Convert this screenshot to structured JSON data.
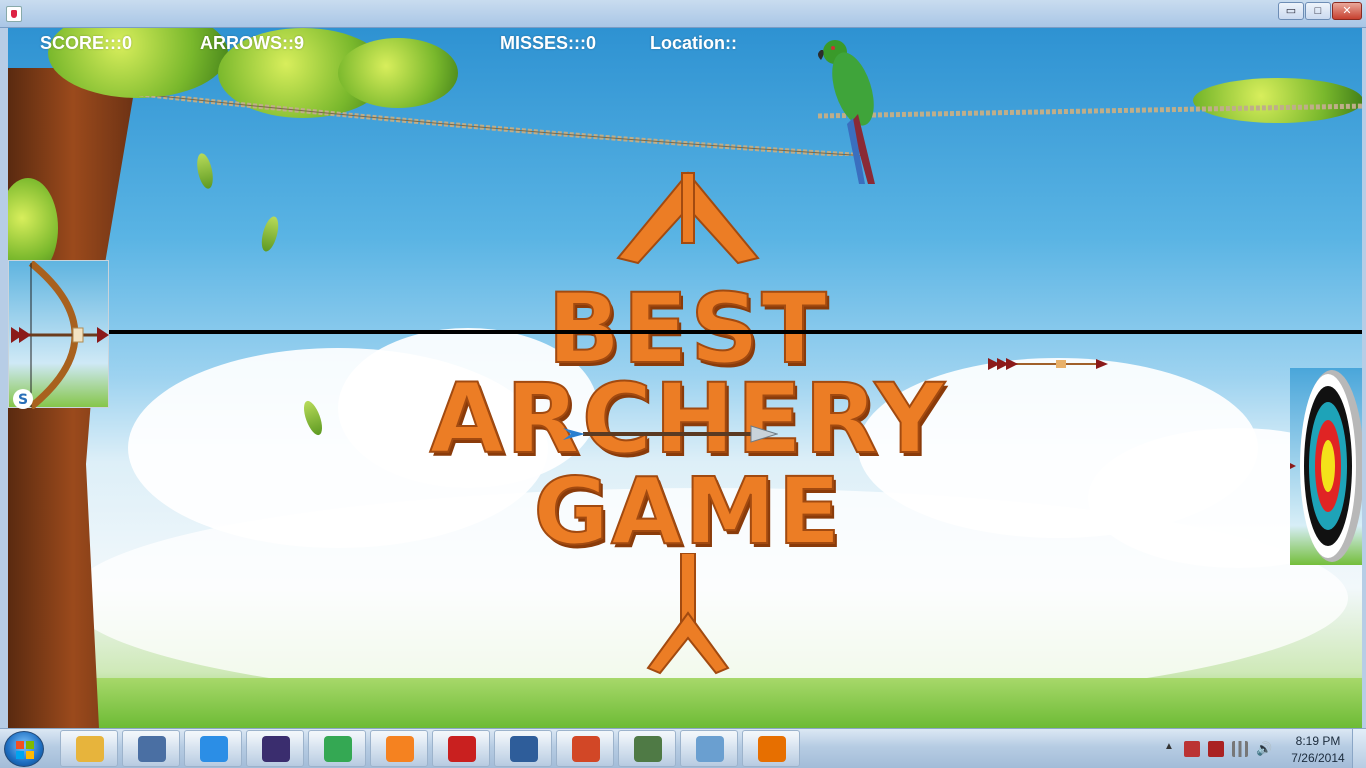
{
  "hud": {
    "score": "SCORE:::0",
    "arrows": "ARROWS::9",
    "misses": "MISSES:::0",
    "location": "Location::"
  },
  "logo": {
    "line1": "BEST",
    "line2": "ARCHERY",
    "line3": "GAME"
  },
  "window": {
    "min_label": "▭",
    "max_label": "□",
    "close_label": "✕"
  },
  "taskbar": {
    "items": [
      {
        "icon": "file-explorer-icon",
        "color": "#e7b43c"
      },
      {
        "icon": "notepad-icon",
        "color": "#4a6fa3"
      },
      {
        "icon": "itunes-icon",
        "color": "#2b8ee6"
      },
      {
        "icon": "eclipse-icon",
        "color": "#3a2d6e"
      },
      {
        "icon": "chrome-icon",
        "color": "#34a853"
      },
      {
        "icon": "vlc-icon",
        "color": "#f58220"
      },
      {
        "icon": "acrobat-icon",
        "color": "#c9201f"
      },
      {
        "icon": "virtualbox-icon",
        "color": "#2e5d9a"
      },
      {
        "icon": "powerpoint-icon",
        "color": "#d24726"
      },
      {
        "icon": "window-app-icon",
        "color": "#4f7a45"
      },
      {
        "icon": "paint-icon",
        "color": "#6a9fd0"
      },
      {
        "icon": "java-icon",
        "color": "#e76f00"
      }
    ],
    "time": "8:19 PM",
    "date": "7/26/2014"
  },
  "colors": {
    "logo_orange": "#ec7d25",
    "hud_text": "#ffffff",
    "aim_line": "#000000"
  }
}
